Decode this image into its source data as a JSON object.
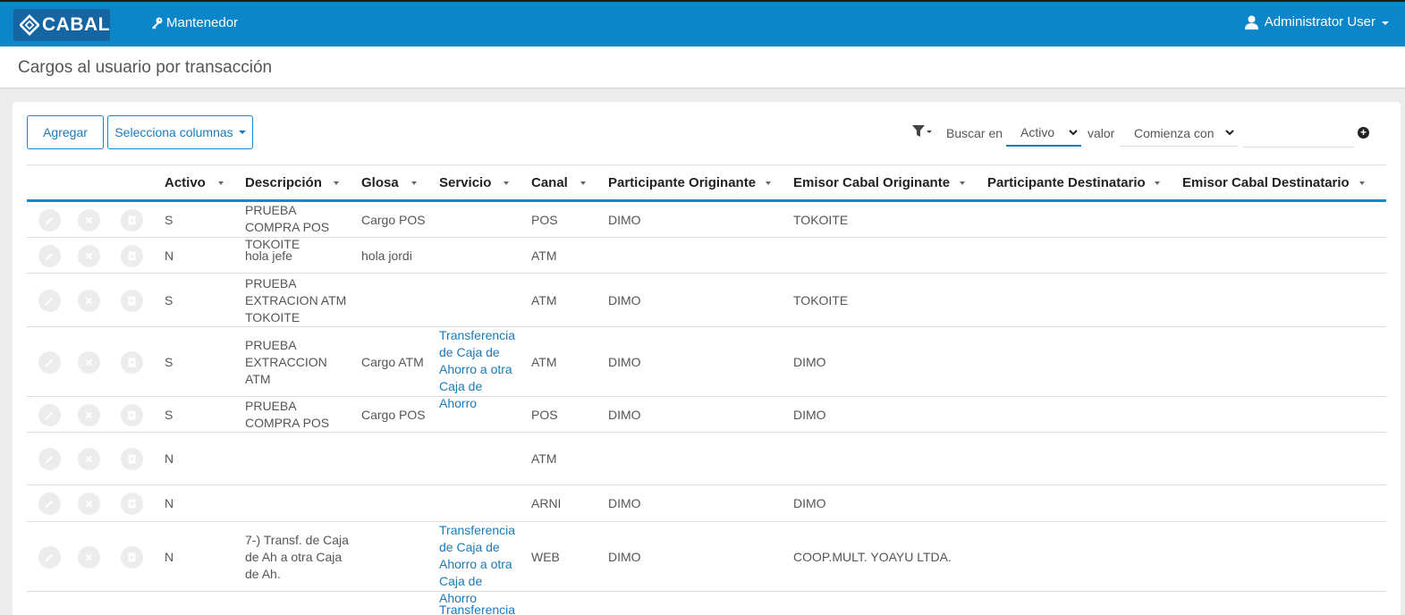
{
  "navbar": {
    "brand": "CABAL",
    "menu_label": "Mantenedor",
    "user_label": "Administrator User"
  },
  "page": {
    "title": "Cargos al usuario por transacción"
  },
  "toolbar": {
    "add_label": "Agregar",
    "columns_label": "Selecciona columnas",
    "search_in_label": "Buscar en",
    "search_field": "Activo",
    "value_label": "valor",
    "match_mode": "Comienza con",
    "search_value": ""
  },
  "table": {
    "columns": [
      "Activo",
      "Descripción",
      "Glosa",
      "Servicio",
      "Canal",
      "Participante Originante",
      "Emisor Cabal Originante",
      "Participante Destinatario",
      "Emisor Cabal Destinatario"
    ],
    "rows": [
      {
        "activo": "S",
        "descripcion": "PRUEBA COMPRA POS TOKOITE",
        "glosa": "Cargo POS",
        "servicio": "",
        "canal": "POS",
        "part_orig": "DIMO",
        "emisor_orig": "TOKOITE"
      },
      {
        "activo": "N",
        "descripcion": "hola jefe",
        "glosa": "hola jordi",
        "servicio": "",
        "canal": "ATM",
        "part_orig": "",
        "emisor_orig": ""
      },
      {
        "activo": "S",
        "descripcion": "PRUEBA EXTRACION ATM TOKOITE",
        "glosa": "",
        "servicio": "",
        "canal": "ATM",
        "part_orig": "DIMO",
        "emisor_orig": "TOKOITE"
      },
      {
        "activo": "S",
        "descripcion": "PRUEBA EXTRACCION ATM",
        "glosa": "Cargo ATM",
        "servicio": "Transferencia de Caja de Ahorro a otra Caja de Ahorro",
        "canal": "ATM",
        "part_orig": "DIMO",
        "emisor_orig": "DIMO"
      },
      {
        "activo": "S",
        "descripcion": "PRUEBA COMPRA POS",
        "glosa": "Cargo POS",
        "servicio": "",
        "canal": "POS",
        "part_orig": "DIMO",
        "emisor_orig": "DIMO"
      },
      {
        "activo": "N",
        "descripcion": "",
        "glosa": "",
        "servicio": "",
        "canal": "ATM",
        "part_orig": "",
        "emisor_orig": ""
      },
      {
        "activo": "N",
        "descripcion": "",
        "glosa": "",
        "servicio": "",
        "canal": "ARNI",
        "part_orig": "DIMO",
        "emisor_orig": "DIMO"
      },
      {
        "activo": "N",
        "descripcion": "7-) Transf. de Caja de Ah a otra Caja de Ah.",
        "glosa": "",
        "servicio": "Transferencia de Caja de Ahorro a otra Caja de Ahorro",
        "canal": "WEB",
        "part_orig": "DIMO",
        "emisor_orig": "COOP.MULT. YOAYU LTDA."
      },
      {
        "activo": "",
        "descripcion": "",
        "glosa": "",
        "servicio": "Transferencia de Caja de Ah",
        "canal": "",
        "part_orig": "",
        "emisor_orig": ""
      }
    ]
  },
  "colors": {
    "navbar": "#0a86c9",
    "brand_bg": "#1565a3",
    "accent": "#1a88c8",
    "link": "#1a7ab8"
  }
}
